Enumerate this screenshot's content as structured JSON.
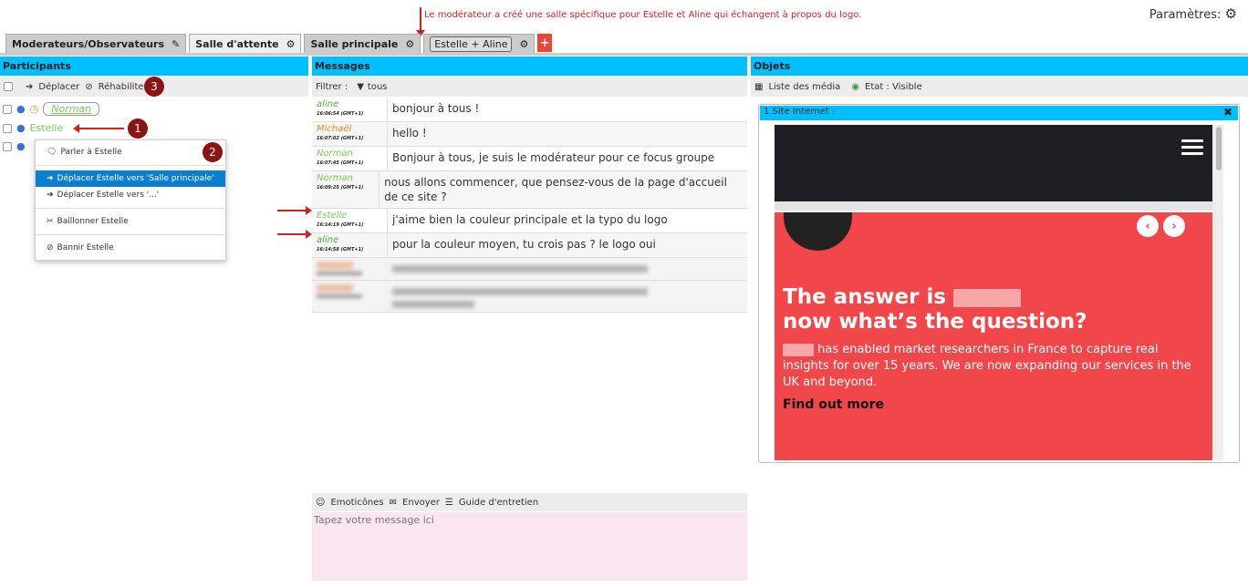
{
  "annotation": "Le modérateur a créé une salle spécifique pour Estelle et Aline qui échangent à propos du logo.",
  "settings_label": "Paramètres:",
  "tabs": [
    {
      "label": "Moderateurs/Observateurs"
    },
    {
      "label": "Salle d'attente"
    },
    {
      "label": "Salle principale"
    },
    {
      "label": "Estelle + Aline"
    }
  ],
  "panels": {
    "participants": "Participants",
    "messages": "Messages",
    "objets": "Objets"
  },
  "participants_toolbar": {
    "move": "Déplacer",
    "rehab": "Réhabiliter"
  },
  "participants": [
    {
      "name": "Norman"
    },
    {
      "name": "Estelle"
    }
  ],
  "badges": [
    "1",
    "2",
    "3"
  ],
  "context_menu": {
    "items": [
      "Parler à Estelle",
      "Déplacer Estelle vers 'Salle principale'",
      "Déplacer Estelle vers '...'",
      "Baillonner Estelle",
      "Bannir Estelle"
    ]
  },
  "filter": {
    "label": "Filtrer :",
    "value": "tous"
  },
  "messages": [
    {
      "author": "aline",
      "time": "16:06:54 (GMT+1)",
      "text": "bonjour à tous !",
      "color": "#5aa832"
    },
    {
      "author": "Michaël",
      "time": "16:07:02 (GMT+1)",
      "text": "hello !",
      "color": "#e08a1a"
    },
    {
      "author": "Norman",
      "time": "16:07:45 (GMT+1)",
      "text": "Bonjour à tous, je suis le modérateur pour ce focus groupe",
      "color": "#7dc95a"
    },
    {
      "author": "Norman",
      "time": "16:09:25 (GMT+1)",
      "text": "nous allons commencer, que pensez-vous de la page d'accueil de ce site ?",
      "color": "#7dc95a"
    },
    {
      "author": "Estelle",
      "time": "16:14:19 (GMT+1)",
      "text": "j'aime bien la couleur principale et la typo du logo",
      "color": "#7dc95a"
    },
    {
      "author": "aline",
      "time": "16:14:58 (GMT+1)",
      "text": "pour la couleur moyen, tu crois pas ? le logo oui",
      "color": "#5aa832"
    }
  ],
  "input_toolbar": {
    "emoticons": "Emoticônes",
    "send": "Envoyer",
    "guide": "Guide d'entretien"
  },
  "input_placeholder": "Tapez votre message ici",
  "objets_toolbar": {
    "media_list": "Liste des média",
    "state": "Etat : Visible"
  },
  "object": {
    "title": "1 Site Internet :",
    "headline_1": "The answer is",
    "headline_2": "now what’s the question?",
    "body": "has enabled market researchers in France to capture real insights for over 15 years. We are now expanding our services in the UK and beyond.",
    "cta": "Find out more"
  }
}
